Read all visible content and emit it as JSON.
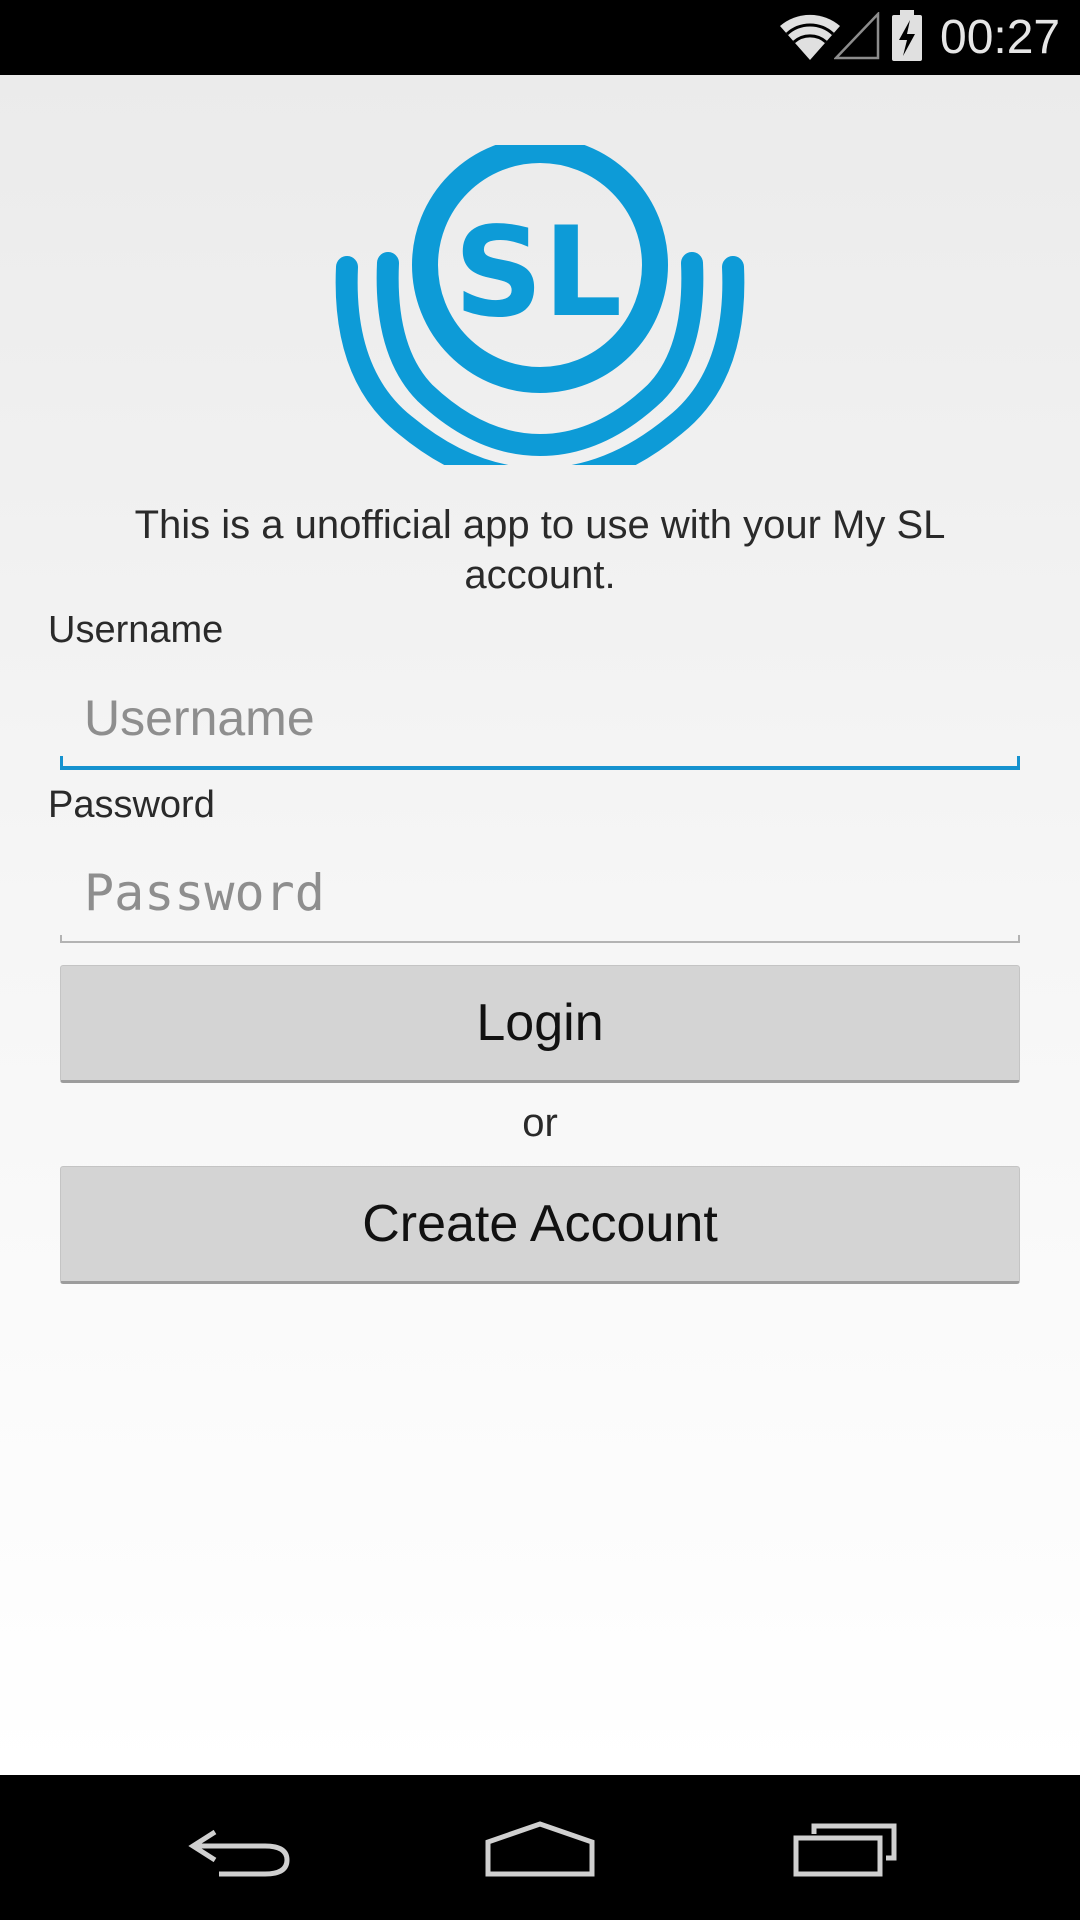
{
  "status_bar": {
    "time": "00:27",
    "icons": [
      "wifi-icon",
      "cell-signal-icon",
      "battery-charging-icon"
    ]
  },
  "app": {
    "logo_text": "SL",
    "brand_color": "#0d9bd7",
    "intro_text": "This is a unofficial app to use with your My SL account.",
    "username_label": "Username",
    "username_placeholder": "Username",
    "username_value": "",
    "password_label": "Password",
    "password_placeholder": "Password",
    "password_value": "",
    "login_label": "Login",
    "or_text": "or",
    "create_account_label": "Create Account",
    "focus_color": "#1592cf"
  },
  "nav_bar": {
    "icons": [
      "back-icon",
      "home-icon",
      "recents-icon"
    ]
  }
}
